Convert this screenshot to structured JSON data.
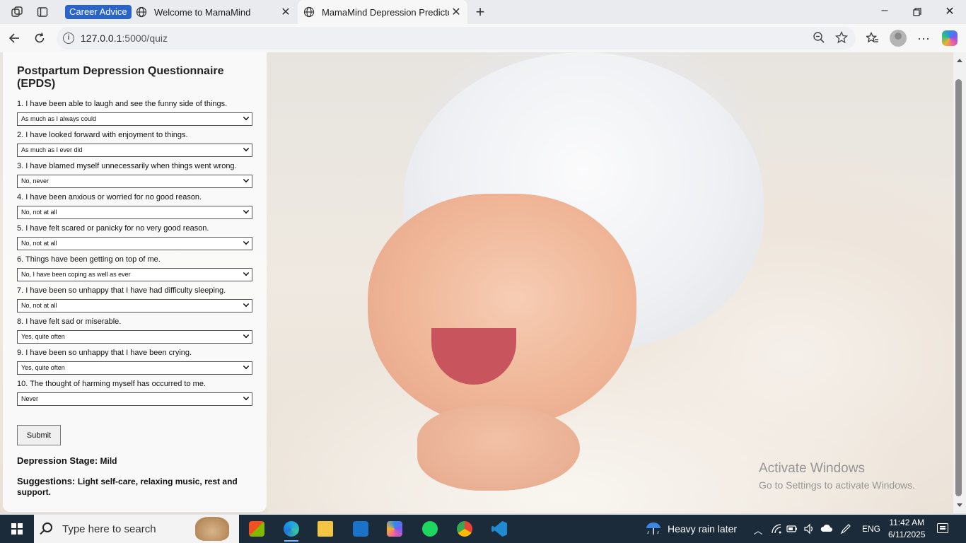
{
  "browser": {
    "tab_group_label": "Career Advice",
    "tabs": [
      {
        "title": "Welcome to MamaMind"
      },
      {
        "title": "MamaMind Depression Predictor"
      }
    ],
    "url_host": "127.0.0.1",
    "url_path": ":5000/quiz"
  },
  "quiz": {
    "title": "Postpartum Depression Questionnaire (EPDS)",
    "questions": [
      {
        "label": "1. I have been able to laugh and see the funny side of things.",
        "selected": "As much as I always could"
      },
      {
        "label": "2. I have looked forward with enjoyment to things.",
        "selected": "As much as I ever did"
      },
      {
        "label": "3. I have blamed myself unnecessarily when things went wrong.",
        "selected": "No, never"
      },
      {
        "label": "4. I have been anxious or worried for no good reason.",
        "selected": "No, not at all"
      },
      {
        "label": "5. I have felt scared or panicky for no very good reason.",
        "selected": "No, not at all"
      },
      {
        "label": "6. Things have been getting on top of me.",
        "selected": "No, I have been coping as well as ever"
      },
      {
        "label": "7. I have been so unhappy that I have had difficulty sleeping.",
        "selected": "No, not at all"
      },
      {
        "label": "8. I have felt sad or miserable.",
        "selected": "Yes, quite often"
      },
      {
        "label": "9. I have been so unhappy that I have been crying.",
        "selected": "Yes, quite often"
      },
      {
        "label": "10. The thought of harming myself has occurred to me.",
        "selected": "Never"
      }
    ],
    "submit_label": "Submit",
    "result_key": "Depression Stage:",
    "result_value": "Mild",
    "suggestion_key": "Suggestions:",
    "suggestion_value": "Light self-care, relaxing music, rest and support."
  },
  "watermark": {
    "line1": "Activate Windows",
    "line2": "Go to Settings to activate Windows."
  },
  "taskbar": {
    "search_placeholder": "Type here to search",
    "weather": "Heavy rain later",
    "language": "ENG",
    "time": "11:42 AM",
    "date": "6/11/2025"
  },
  "colors": {
    "tab_group": "#2a64c8",
    "taskbar": "#1c2b3a"
  }
}
